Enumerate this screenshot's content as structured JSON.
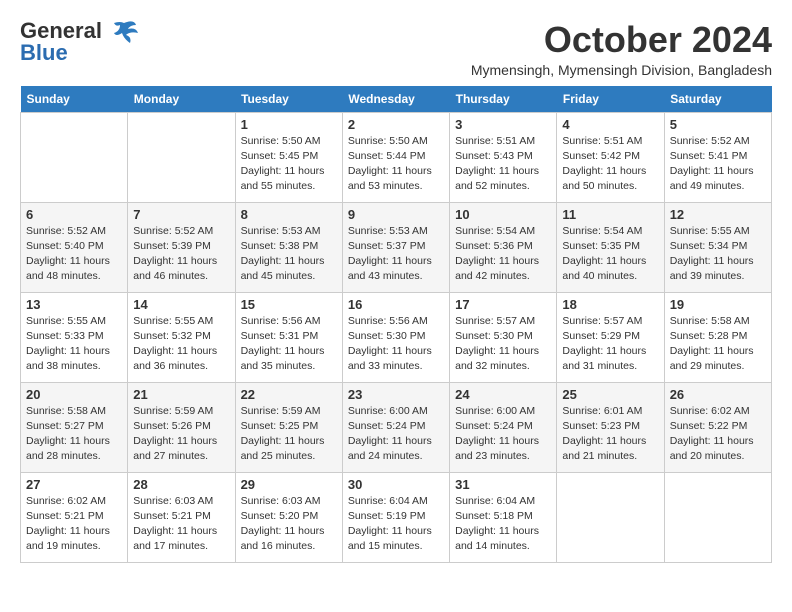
{
  "header": {
    "logo_general": "General",
    "logo_blue": "Blue",
    "month_title": "October 2024",
    "location": "Mymensingh, Mymensingh Division, Bangladesh"
  },
  "weekdays": [
    "Sunday",
    "Monday",
    "Tuesday",
    "Wednesday",
    "Thursday",
    "Friday",
    "Saturday"
  ],
  "weeks": [
    [
      {
        "day": "",
        "info": ""
      },
      {
        "day": "",
        "info": ""
      },
      {
        "day": "1",
        "info": "Sunrise: 5:50 AM\nSunset: 5:45 PM\nDaylight: 11 hours and 55 minutes."
      },
      {
        "day": "2",
        "info": "Sunrise: 5:50 AM\nSunset: 5:44 PM\nDaylight: 11 hours and 53 minutes."
      },
      {
        "day": "3",
        "info": "Sunrise: 5:51 AM\nSunset: 5:43 PM\nDaylight: 11 hours and 52 minutes."
      },
      {
        "day": "4",
        "info": "Sunrise: 5:51 AM\nSunset: 5:42 PM\nDaylight: 11 hours and 50 minutes."
      },
      {
        "day": "5",
        "info": "Sunrise: 5:52 AM\nSunset: 5:41 PM\nDaylight: 11 hours and 49 minutes."
      }
    ],
    [
      {
        "day": "6",
        "info": "Sunrise: 5:52 AM\nSunset: 5:40 PM\nDaylight: 11 hours and 48 minutes."
      },
      {
        "day": "7",
        "info": "Sunrise: 5:52 AM\nSunset: 5:39 PM\nDaylight: 11 hours and 46 minutes."
      },
      {
        "day": "8",
        "info": "Sunrise: 5:53 AM\nSunset: 5:38 PM\nDaylight: 11 hours and 45 minutes."
      },
      {
        "day": "9",
        "info": "Sunrise: 5:53 AM\nSunset: 5:37 PM\nDaylight: 11 hours and 43 minutes."
      },
      {
        "day": "10",
        "info": "Sunrise: 5:54 AM\nSunset: 5:36 PM\nDaylight: 11 hours and 42 minutes."
      },
      {
        "day": "11",
        "info": "Sunrise: 5:54 AM\nSunset: 5:35 PM\nDaylight: 11 hours and 40 minutes."
      },
      {
        "day": "12",
        "info": "Sunrise: 5:55 AM\nSunset: 5:34 PM\nDaylight: 11 hours and 39 minutes."
      }
    ],
    [
      {
        "day": "13",
        "info": "Sunrise: 5:55 AM\nSunset: 5:33 PM\nDaylight: 11 hours and 38 minutes."
      },
      {
        "day": "14",
        "info": "Sunrise: 5:55 AM\nSunset: 5:32 PM\nDaylight: 11 hours and 36 minutes."
      },
      {
        "day": "15",
        "info": "Sunrise: 5:56 AM\nSunset: 5:31 PM\nDaylight: 11 hours and 35 minutes."
      },
      {
        "day": "16",
        "info": "Sunrise: 5:56 AM\nSunset: 5:30 PM\nDaylight: 11 hours and 33 minutes."
      },
      {
        "day": "17",
        "info": "Sunrise: 5:57 AM\nSunset: 5:30 PM\nDaylight: 11 hours and 32 minutes."
      },
      {
        "day": "18",
        "info": "Sunrise: 5:57 AM\nSunset: 5:29 PM\nDaylight: 11 hours and 31 minutes."
      },
      {
        "day": "19",
        "info": "Sunrise: 5:58 AM\nSunset: 5:28 PM\nDaylight: 11 hours and 29 minutes."
      }
    ],
    [
      {
        "day": "20",
        "info": "Sunrise: 5:58 AM\nSunset: 5:27 PM\nDaylight: 11 hours and 28 minutes."
      },
      {
        "day": "21",
        "info": "Sunrise: 5:59 AM\nSunset: 5:26 PM\nDaylight: 11 hours and 27 minutes."
      },
      {
        "day": "22",
        "info": "Sunrise: 5:59 AM\nSunset: 5:25 PM\nDaylight: 11 hours and 25 minutes."
      },
      {
        "day": "23",
        "info": "Sunrise: 6:00 AM\nSunset: 5:24 PM\nDaylight: 11 hours and 24 minutes."
      },
      {
        "day": "24",
        "info": "Sunrise: 6:00 AM\nSunset: 5:24 PM\nDaylight: 11 hours and 23 minutes."
      },
      {
        "day": "25",
        "info": "Sunrise: 6:01 AM\nSunset: 5:23 PM\nDaylight: 11 hours and 21 minutes."
      },
      {
        "day": "26",
        "info": "Sunrise: 6:02 AM\nSunset: 5:22 PM\nDaylight: 11 hours and 20 minutes."
      }
    ],
    [
      {
        "day": "27",
        "info": "Sunrise: 6:02 AM\nSunset: 5:21 PM\nDaylight: 11 hours and 19 minutes."
      },
      {
        "day": "28",
        "info": "Sunrise: 6:03 AM\nSunset: 5:21 PM\nDaylight: 11 hours and 17 minutes."
      },
      {
        "day": "29",
        "info": "Sunrise: 6:03 AM\nSunset: 5:20 PM\nDaylight: 11 hours and 16 minutes."
      },
      {
        "day": "30",
        "info": "Sunrise: 6:04 AM\nSunset: 5:19 PM\nDaylight: 11 hours and 15 minutes."
      },
      {
        "day": "31",
        "info": "Sunrise: 6:04 AM\nSunset: 5:18 PM\nDaylight: 11 hours and 14 minutes."
      },
      {
        "day": "",
        "info": ""
      },
      {
        "day": "",
        "info": ""
      }
    ]
  ]
}
